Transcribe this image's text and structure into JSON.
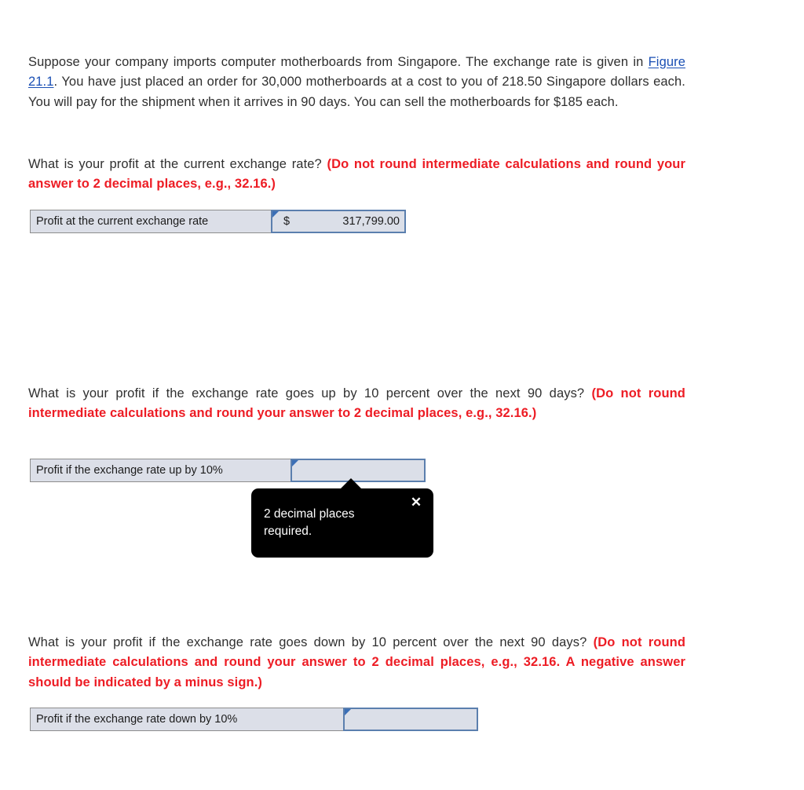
{
  "intro": {
    "part1": "Suppose your company imports computer motherboards from Singapore. The exchange rate is given in ",
    "link": "Figure 21.1",
    "part2": ". You have just placed an order for 30,000 motherboards at a cost to you of 218.50 Singapore dollars each. You will pay for the shipment when it arrives in 90 days. You can sell the motherboards for $185 each."
  },
  "questions": [
    {
      "prompt": "What is your profit at the current exchange rate? ",
      "note": "(Do not round intermediate calculations and round your answer to 2 decimal places, e.g., 32.16.)",
      "label": "Profit at the current exchange rate",
      "currency": "$",
      "value": "317,799.00"
    },
    {
      "prompt": "What is your profit if the exchange rate goes up by 10 percent over the next 90 days? ",
      "note": "(Do not round intermediate calculations and round your answer to 2 decimal places, e.g., 32.16.)",
      "label": "Profit if the exchange rate up by 10%",
      "currency": "",
      "value": ""
    },
    {
      "prompt": "What is your profit if the exchange rate goes down by 10 percent over the next 90 days? ",
      "note": "(Do not round intermediate calculations and round your answer to 2 decimal places, e.g., 32.16. A negative answer should be indicated by a minus sign.)",
      "label": "Profit if the exchange rate down by 10%",
      "currency": "",
      "value": ""
    }
  ],
  "tooltip": {
    "message": "2 decimal places required.",
    "close_label": "✕"
  },
  "colors": {
    "link": "#1a4fb4",
    "emphasis": "#ed1c24",
    "field_border": "#5b7fae",
    "field_background": "#dbdfe8",
    "label_background": "#dcdfe8",
    "tooltip_background": "#000000"
  }
}
